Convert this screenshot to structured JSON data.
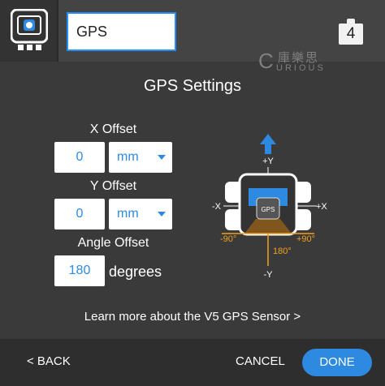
{
  "header": {
    "device_name": "GPS",
    "port_number": "4",
    "device_icon": "vex-device-icon",
    "port_icon": "port-badge-icon"
  },
  "watermark": {
    "logo": "C",
    "cn_text": "庫樂思",
    "en_text": "URIOUS"
  },
  "main": {
    "title": "GPS Settings",
    "x_offset": {
      "label": "X Offset",
      "value": "0",
      "unit": "mm"
    },
    "y_offset": {
      "label": "Y Offset",
      "value": "0",
      "unit": "mm"
    },
    "angle_offset": {
      "label": "Angle Offset",
      "value": "180",
      "unit": "degrees"
    },
    "learn_more": "Learn more about the V5 GPS Sensor >"
  },
  "diagram": {
    "plus_y": "+Y",
    "minus_y": "-Y",
    "plus_x": "+X",
    "minus_x": "-X",
    "sensor_label": "GPS",
    "angle_left": "-90°",
    "angle_right": "+90°",
    "angle_bottom": "180°",
    "arrow_color": "#2d8ae0",
    "accent_color": "#f0a020"
  },
  "footer": {
    "back_label": "< BACK",
    "cancel_label": "CANCEL",
    "done_label": "DONE"
  }
}
